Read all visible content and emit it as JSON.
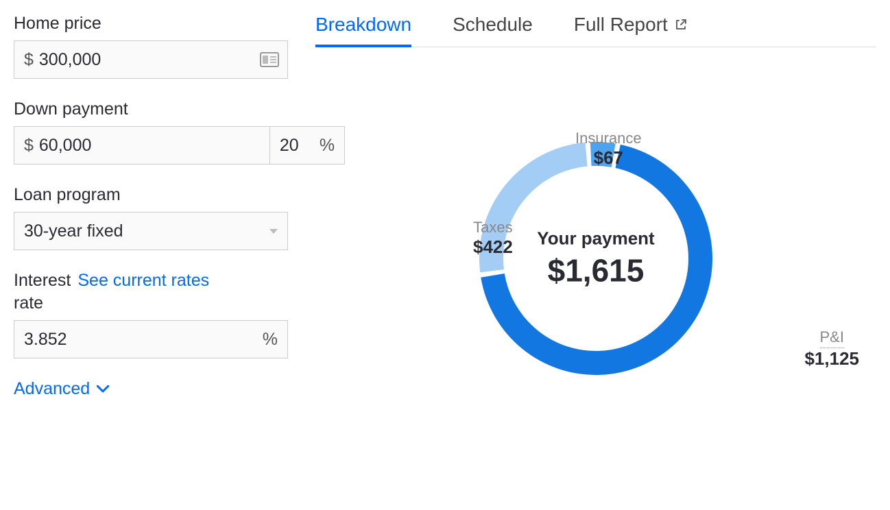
{
  "form": {
    "home_price": {
      "label": "Home price",
      "value": "300,000"
    },
    "down_payment": {
      "label": "Down payment",
      "value": "60,000",
      "percent": "20"
    },
    "loan_program": {
      "label": "Loan program",
      "value": "30-year fixed"
    },
    "interest": {
      "label_part1": "Interest",
      "label_part2": "rate",
      "link": "See current rates",
      "value": "3.852"
    },
    "advanced": "Advanced"
  },
  "symbols": {
    "dollar": "$",
    "percent": "%"
  },
  "tabs": {
    "breakdown": "Breakdown",
    "schedule": "Schedule",
    "full_report": "Full Report"
  },
  "payment": {
    "label": "Your payment",
    "amount": "$1,615"
  },
  "callouts": {
    "insurance": {
      "name": "Insurance",
      "value": "$67"
    },
    "taxes": {
      "name": "Taxes",
      "value": "$422"
    },
    "pi": {
      "name": "P&I",
      "value": "$1,125"
    }
  },
  "colors": {
    "accent": "#006aff",
    "pi": "#1277e1",
    "taxes": "#a3cdf5",
    "insurance": "#4ea3ef"
  },
  "chart_data": {
    "type": "pie",
    "title": "Your payment",
    "total_label": "$1,615",
    "series": [
      {
        "name": "P&I",
        "value": 1125,
        "color": "#1277e1"
      },
      {
        "name": "Taxes",
        "value": 422,
        "color": "#a3cdf5"
      },
      {
        "name": "Insurance",
        "value": 67,
        "color": "#4ea3ef"
      }
    ]
  }
}
